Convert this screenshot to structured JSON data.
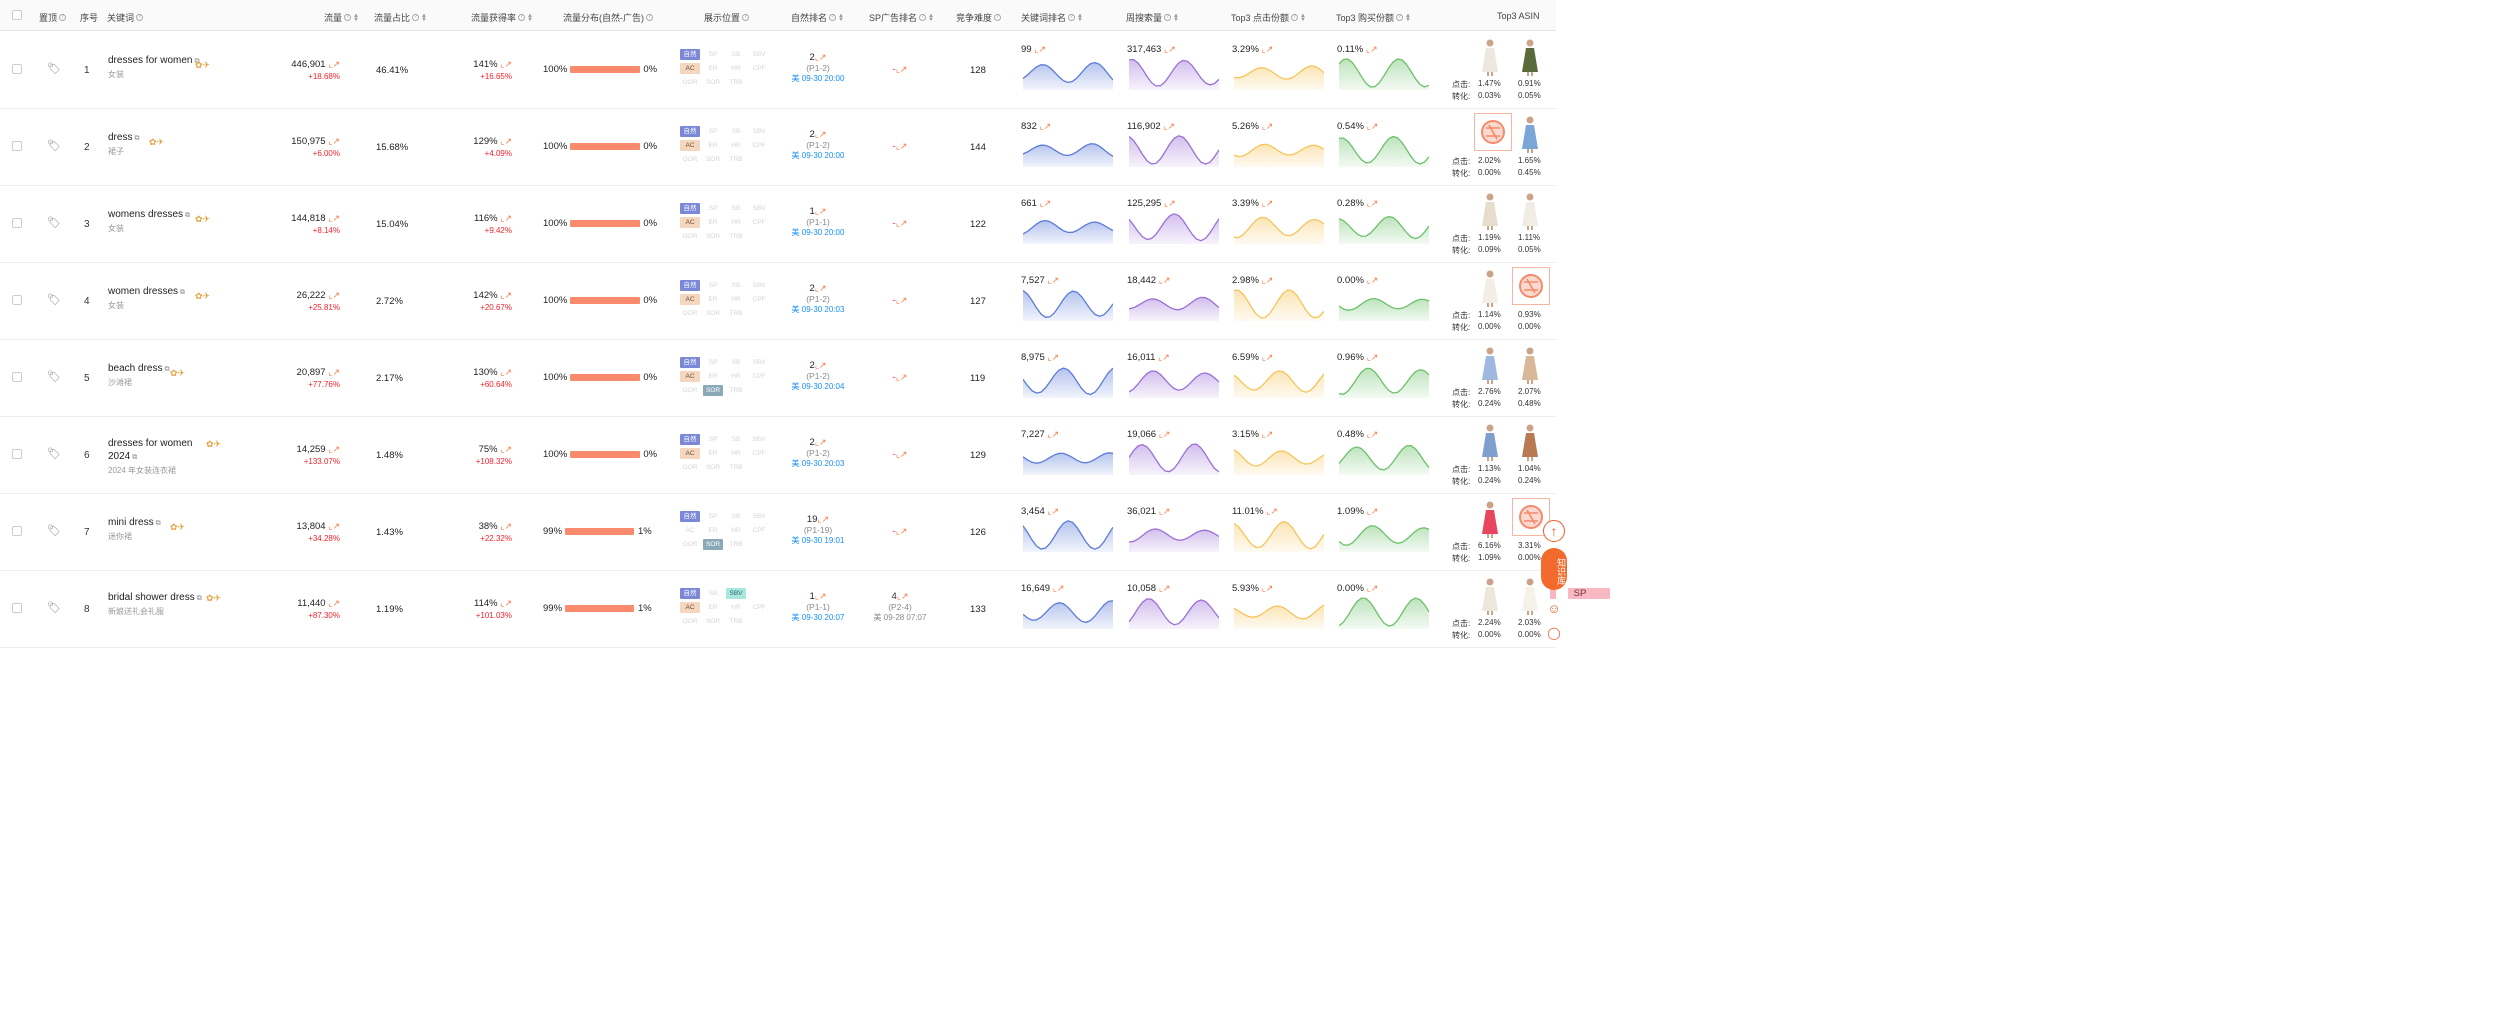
{
  "headers": {
    "pin": "置顶",
    "seq": "序号",
    "keyword": "关键词",
    "traffic": "流量",
    "traffic_share": "流量占比",
    "acquisition_rate": "流量获得率",
    "distribution": "流量分布(自然-广告)",
    "display_position": "展示位置",
    "natural_rank": "自然排名",
    "sp_ad_rank": "SP广告排名",
    "competition": "竞争难度",
    "keyword_rank": "关键词排名",
    "weekly_search": "周搜索量",
    "top3_click_share": "Top3 点击份额",
    "top3_purchase_share": "Top3 购买份额",
    "top3_asin": "Top3 ASIN"
  },
  "labels": {
    "click": "点击:",
    "conversion": "转化:"
  },
  "badges": [
    "自然",
    "SP",
    "SB",
    "SBV",
    "AC",
    "ER",
    "HR",
    "CPF",
    "OOR",
    "SOR",
    "TRB"
  ],
  "floating": {
    "kb": "知识库"
  },
  "rows": [
    {
      "idx": "1",
      "keyword": "dresses for women",
      "sub": "女装",
      "traffic": "446,901",
      "traffic_delta": "+18.68%",
      "share": "46.41%",
      "acq": "141%",
      "acq_delta": "+16.65%",
      "dist_left": "100%",
      "dist_right": "0%",
      "dist_fill": 1.0,
      "active": [
        "自然",
        "AC"
      ],
      "rank": "2",
      "rank_pages": "(P1-2)",
      "rank_time": "美 09-30 20:00",
      "sp": "-",
      "sp_pages": "",
      "sp_time": "",
      "competition": "128",
      "kw_rank": "99",
      "weekly": "317,463",
      "click_share": "3.29%",
      "buy_share": "0.11%",
      "a1_click": "1.47%",
      "a1_conv": "0.03%",
      "a2_click": "0.91%",
      "a2_conv": "0.05%",
      "sel": 0
    },
    {
      "idx": "2",
      "keyword": "dress",
      "sub": "裙子",
      "traffic": "150,975",
      "traffic_delta": "+6.00%",
      "share": "15.68%",
      "acq": "129%",
      "acq_delta": "+4.09%",
      "dist_left": "100%",
      "dist_right": "0%",
      "dist_fill": 1.0,
      "active": [
        "自然",
        "AC"
      ],
      "rank": "2",
      "rank_pages": "(P1-2)",
      "rank_time": "美 09-30 20:00",
      "sp": "-",
      "sp_pages": "",
      "sp_time": "",
      "competition": "144",
      "kw_rank": "832",
      "weekly": "116,902",
      "click_share": "5.26%",
      "buy_share": "0.54%",
      "a1_click": "2.02%",
      "a1_conv": "0.00%",
      "a2_click": "1.65%",
      "a2_conv": "0.45%",
      "sel": 1
    },
    {
      "idx": "3",
      "keyword": "womens dresses",
      "sub": "女装",
      "traffic": "144,818",
      "traffic_delta": "+8.14%",
      "share": "15.04%",
      "acq": "116%",
      "acq_delta": "+9.42%",
      "dist_left": "100%",
      "dist_right": "0%",
      "dist_fill": 1.0,
      "active": [
        "自然",
        "AC"
      ],
      "rank": "1",
      "rank_pages": "(P1-1)",
      "rank_time": "美 09-30 20:00",
      "sp": "-",
      "sp_pages": "",
      "sp_time": "",
      "competition": "122",
      "kw_rank": "661",
      "weekly": "125,295",
      "click_share": "3.39%",
      "buy_share": "0.28%",
      "a1_click": "1.19%",
      "a1_conv": "0.09%",
      "a2_click": "1.11%",
      "a2_conv": "0.05%",
      "sel": 0
    },
    {
      "idx": "4",
      "keyword": "women dresses",
      "sub": "女装",
      "traffic": "26,222",
      "traffic_delta": "+25.81%",
      "share": "2.72%",
      "acq": "142%",
      "acq_delta": "+20.67%",
      "dist_left": "100%",
      "dist_right": "0%",
      "dist_fill": 1.0,
      "active": [
        "自然",
        "AC"
      ],
      "rank": "2",
      "rank_pages": "(P1-2)",
      "rank_time": "美 09-30 20:03",
      "sp": "-",
      "sp_pages": "",
      "sp_time": "",
      "competition": "127",
      "kw_rank": "7,527",
      "weekly": "18,442",
      "click_share": "2.98%",
      "buy_share": "0.00%",
      "a1_click": "1.14%",
      "a1_conv": "0.00%",
      "a2_click": "0.93%",
      "a2_conv": "0.00%",
      "sel": 2
    },
    {
      "idx": "5",
      "keyword": "beach dress",
      "sub": "沙滩裙",
      "traffic": "20,897",
      "traffic_delta": "+77.76%",
      "share": "2.17%",
      "acq": "130%",
      "acq_delta": "+60.64%",
      "dist_left": "100%",
      "dist_right": "0%",
      "dist_fill": 1.0,
      "active": [
        "自然",
        "AC",
        "SOR"
      ],
      "rank": "2",
      "rank_pages": "(P1-2)",
      "rank_time": "美 09-30 20:04",
      "sp": "-",
      "sp_pages": "",
      "sp_time": "",
      "competition": "119",
      "kw_rank": "8,975",
      "weekly": "16,011",
      "click_share": "6.59%",
      "buy_share": "0.96%",
      "a1_click": "2.76%",
      "a1_conv": "0.24%",
      "a2_click": "2.07%",
      "a2_conv": "0.48%",
      "sel": 0
    },
    {
      "idx": "6",
      "keyword": "dresses for women 2024",
      "sub": "2024 年女装连衣裙",
      "traffic": "14,259",
      "traffic_delta": "+133.07%",
      "share": "1.48%",
      "acq": "75%",
      "acq_delta": "+108.32%",
      "dist_left": "100%",
      "dist_right": "0%",
      "dist_fill": 1.0,
      "active": [
        "自然",
        "AC"
      ],
      "rank": "2",
      "rank_pages": "(P1-2)",
      "rank_time": "美 09-30 20:03",
      "sp": "-",
      "sp_pages": "",
      "sp_time": "",
      "competition": "129",
      "kw_rank": "7,227",
      "weekly": "19,066",
      "click_share": "3.15%",
      "buy_share": "0.48%",
      "a1_click": "1.13%",
      "a1_conv": "0.24%",
      "a2_click": "1.04%",
      "a2_conv": "0.24%",
      "sel": 0
    },
    {
      "idx": "7",
      "keyword": "mini dress",
      "sub": "迷你裙",
      "traffic": "13,804",
      "traffic_delta": "+34.28%",
      "share": "1.43%",
      "acq": "38%",
      "acq_delta": "+22.32%",
      "dist_left": "99%",
      "dist_right": "1%",
      "dist_fill": 0.99,
      "active": [
        "自然",
        "SOR"
      ],
      "rank": "19",
      "rank_pages": "(P1-19)",
      "rank_time": "美 09-30 19:01",
      "sp": "-",
      "sp_pages": "",
      "sp_time": "",
      "competition": "126",
      "kw_rank": "3,454",
      "weekly": "36,021",
      "click_share": "11.01%",
      "buy_share": "1.09%",
      "a1_click": "6.16%",
      "a1_conv": "1.09%",
      "a2_click": "3.31%",
      "a2_conv": "0.00%",
      "sel": 2
    },
    {
      "idx": "8",
      "keyword": "bridal shower dress",
      "sub": "新娘送礼会礼服",
      "traffic": "11,440",
      "traffic_delta": "+87.30%",
      "share": "1.19%",
      "acq": "114%",
      "acq_delta": "+101.03%",
      "dist_left": "99%",
      "dist_right": "1%",
      "dist_fill": 0.99,
      "active": [
        "自然",
        "SP",
        "SBV",
        "AC"
      ],
      "rank": "1",
      "rank_pages": "(P1-1)",
      "rank_time": "美 09-30 20:07",
      "sp": "4",
      "sp_pages": "(P2-4)",
      "sp_time": "美 09-28 07:07",
      "competition": "133",
      "kw_rank": "16,649",
      "weekly": "10,058",
      "click_share": "5.93%",
      "buy_share": "0.00%",
      "a1_click": "2.24%",
      "a1_conv": "0.00%",
      "a2_click": "2.03%",
      "a2_conv": "0.00%",
      "sel": 0
    }
  ],
  "colors": {
    "blue": "#5b7bd8",
    "purple": "#9b6fd6",
    "yellow": "#f5c45a",
    "green": "#6cc16b",
    "accent": "#ff7a45",
    "red": "#f5222d"
  }
}
